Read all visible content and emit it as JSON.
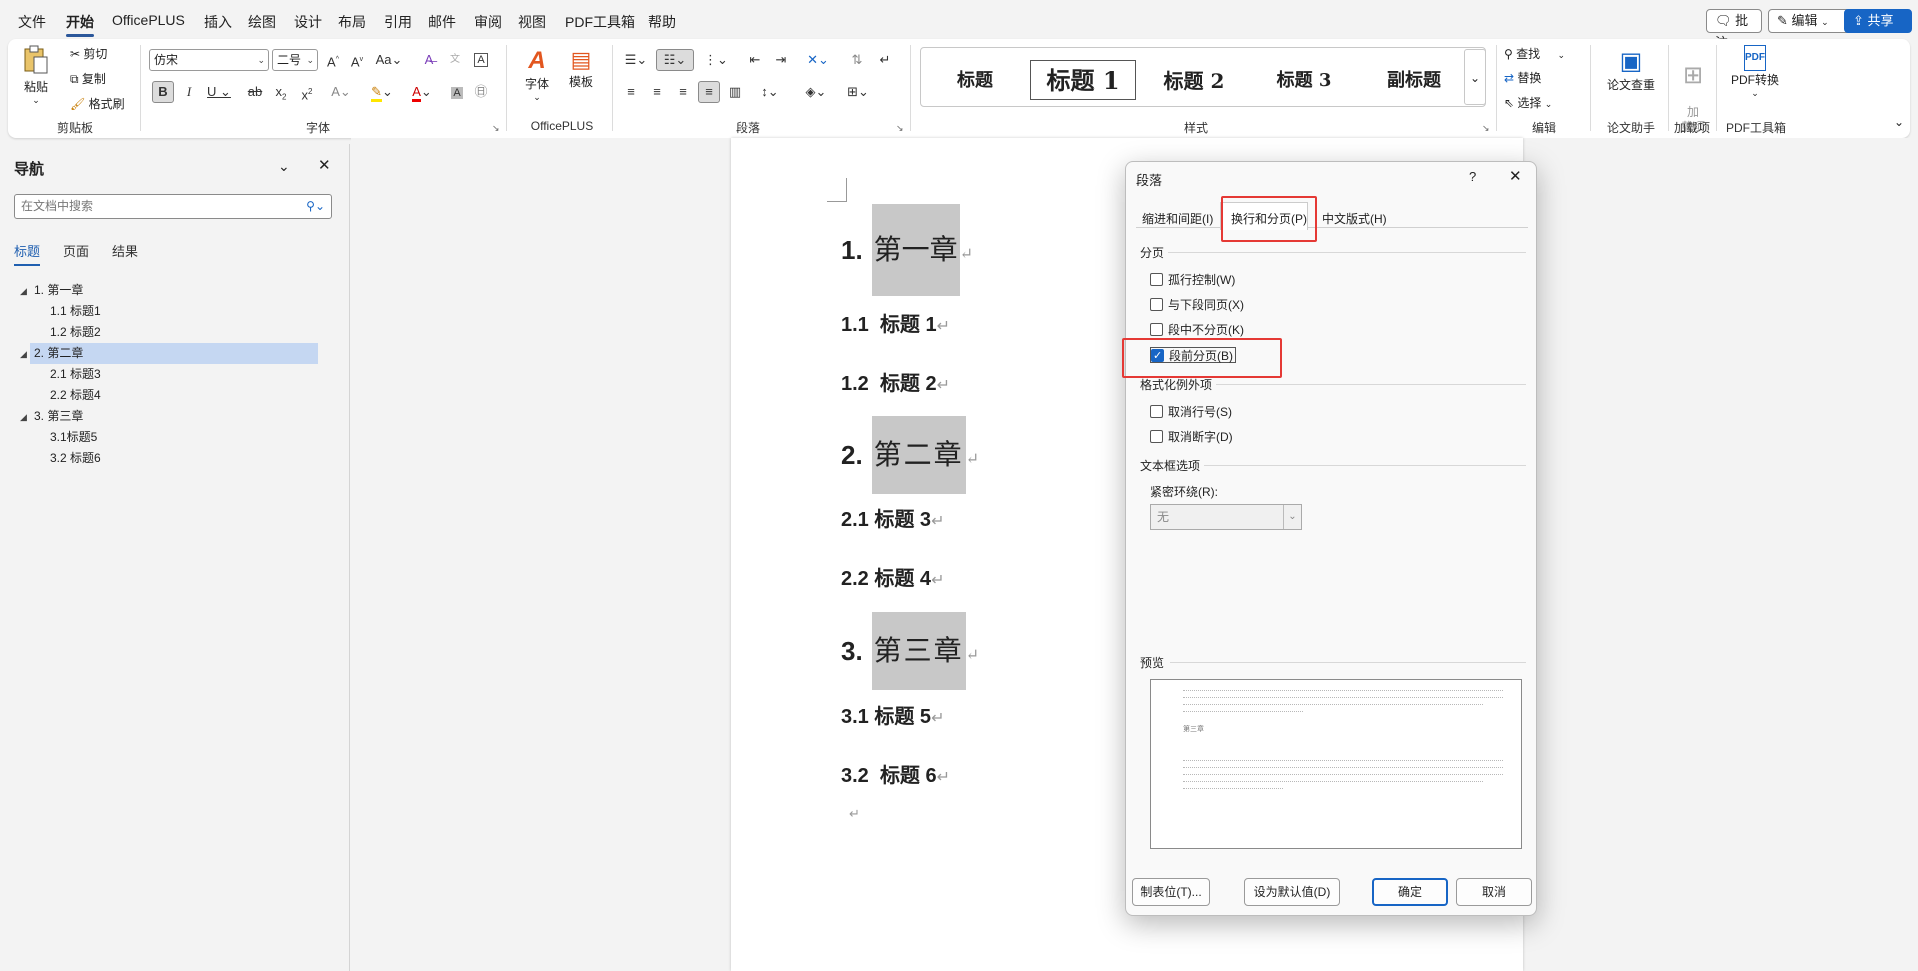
{
  "menubar": {
    "items": [
      "文件",
      "开始",
      "OfficePLUS",
      "插入",
      "绘图",
      "设计",
      "布局",
      "引用",
      "邮件",
      "审阅",
      "视图",
      "PDF工具箱",
      "帮助"
    ],
    "comment_label": "批注",
    "edit_label": "编辑",
    "share_label": "共享"
  },
  "ribbon": {
    "clipboard": {
      "paste": "粘贴",
      "cut": "剪切",
      "copy": "复制",
      "format_painter": "格式刷",
      "label": "剪贴板"
    },
    "font": {
      "name": "仿宋",
      "size": "二号",
      "label": "字体"
    },
    "officeplus": {
      "font_btn": "字体",
      "template_btn": "模板",
      "label": "OfficePLUS"
    },
    "paragraph": {
      "label": "段落"
    },
    "styles": {
      "items": [
        "标题",
        "标题 1",
        "标题 2",
        "标题 3",
        "副标题"
      ],
      "label": "样式"
    },
    "editing": {
      "find": "查找",
      "replace": "替换",
      "select": "选择",
      "label": "编辑"
    },
    "paper": {
      "check": "论文查重",
      "label": "论文助手"
    },
    "addins": {
      "btn": "加\n载项",
      "label": "加载项"
    },
    "pdf": {
      "convert": "PDF转换",
      "label": "PDF工具箱"
    }
  },
  "nav": {
    "title": "导航",
    "search_placeholder": "在文档中搜索",
    "tabs": [
      "标题",
      "页面",
      "结果"
    ],
    "tree": [
      {
        "label": "1. 第一章",
        "level": 1
      },
      {
        "label": "1.1 标题1",
        "level": 2
      },
      {
        "label": "1.2 标题2",
        "level": 2
      },
      {
        "label": "2. 第二章",
        "level": 1,
        "selected": true
      },
      {
        "label": "2.1 标题3",
        "level": 2
      },
      {
        "label": "2.2 标题4",
        "level": 2
      },
      {
        "label": "3. 第三章",
        "level": 1
      },
      {
        "label": "3.1标题5",
        "level": 2
      },
      {
        "label": "3.2 标题6",
        "level": 2
      }
    ]
  },
  "document": {
    "h1": [
      {
        "num": "1.",
        "text": "第一章"
      },
      {
        "num": "2.",
        "text": "第二章"
      },
      {
        "num": "3.",
        "text": "第三章"
      }
    ],
    "h2": [
      {
        "num": "1.1",
        "text": "标题 1"
      },
      {
        "num": "1.2",
        "text": "标题 2"
      },
      {
        "num": "2.1",
        "text": "标题 3"
      },
      {
        "num": "2.2",
        "text": "标题 4"
      },
      {
        "num": "3.1",
        "text": "标题 5"
      },
      {
        "num": "3.2",
        "text": "标题 6"
      }
    ],
    "para_mark": "↵"
  },
  "dialog": {
    "title": "段落",
    "help": "?",
    "tabs": [
      "缩进和间距(I)",
      "换行和分页(P)",
      "中文版式(H)"
    ],
    "pagination_label": "分页",
    "options": [
      {
        "label": "孤行控制(W)",
        "checked": false
      },
      {
        "label": "与下段同页(X)",
        "checked": false
      },
      {
        "label": "段中不分页(K)",
        "checked": false
      },
      {
        "label": "段前分页(B)",
        "checked": true
      }
    ],
    "format_exceptions_label": "格式化例外项",
    "exceptions": [
      {
        "label": "取消行号(S)",
        "checked": false
      },
      {
        "label": "取消断字(D)",
        "checked": false
      }
    ],
    "textbox_label": "文本框选项",
    "tight_wrap_label": "紧密环绕(R):",
    "tight_wrap_value": "无",
    "preview_label": "预览",
    "preview_heading": "第三章",
    "buttons": {
      "tabs": "制表位(T)...",
      "default": "设为默认值(D)",
      "ok": "确定",
      "cancel": "取消"
    }
  }
}
